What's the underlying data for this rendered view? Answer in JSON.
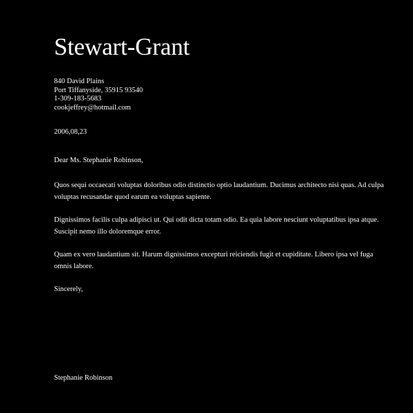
{
  "letter": {
    "company": "Stewart-Grant",
    "address_lines": [
      "840 David Plains",
      "Port Tiffanyside, 35915 93540",
      "1-309-183-5683",
      "cookjeffrey@hotmail.com"
    ],
    "date": "2006,08,23",
    "salutation": "Dear Ms. Stephanie Robinson,",
    "paragraphs": [
      "Quos sequi occaecati voluptas doloribus odio distinctio optio laudantium. Ducimus architecto nisi quas. Ad culpa voluptas recusandae quod earum ea voluptas sapiente.",
      "Dignissimos facilis culpa adipisci ut. Qui odit dicta totam odio. Ea quia labore nesciunt voluptatibus ipsa atque. Suscipit nemo illo doloremque error.",
      "Quam ex vero laudantium sit. Harum dignissimos excepturi reiciendis fugit et cupiditate. Libero ipsa vel fuga omnis labore."
    ],
    "closing": "Sincerely,",
    "signature": "Stephanie Robinson"
  },
  "colors": {
    "background": "#000000",
    "text": "#ffffff"
  }
}
